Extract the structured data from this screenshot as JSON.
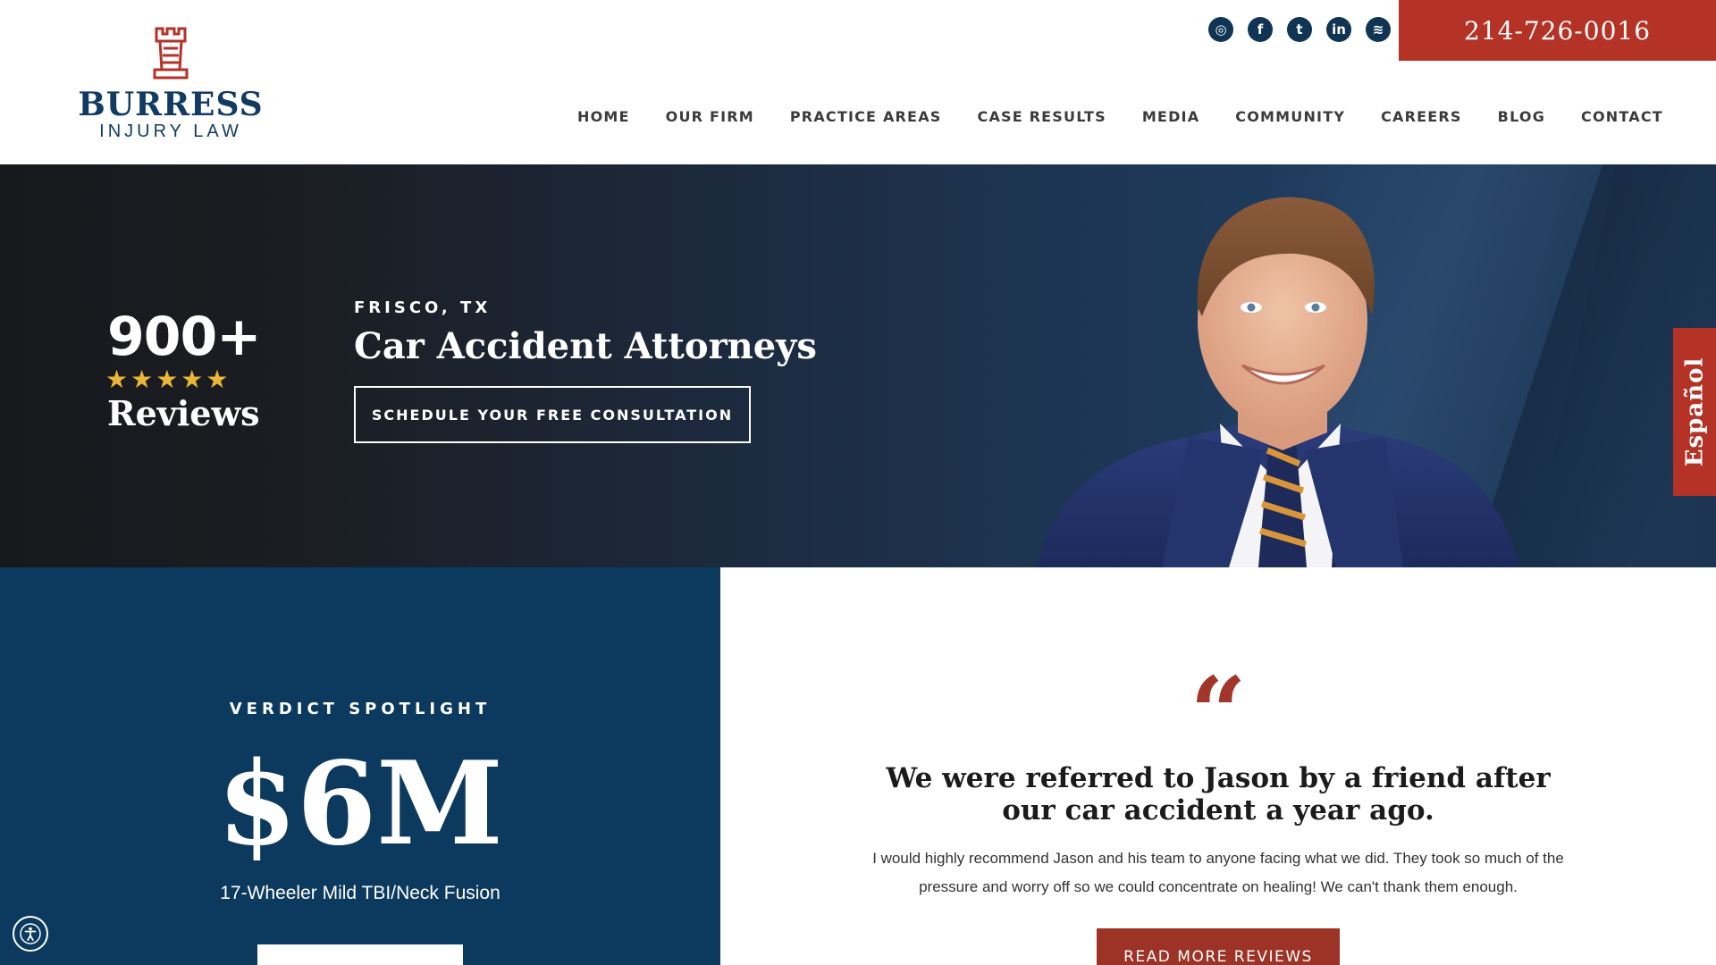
{
  "brand": {
    "name": "BURRESS",
    "tagline": "INJURY LAW",
    "colors": {
      "navy": "#123b63",
      "red": "#b53227",
      "gold": "#e9b63a"
    }
  },
  "social": [
    {
      "name": "instagram",
      "glyph": "◎"
    },
    {
      "name": "facebook",
      "glyph": "f"
    },
    {
      "name": "twitter",
      "glyph": "t"
    },
    {
      "name": "linkedin",
      "glyph": "in"
    },
    {
      "name": "spotify",
      "glyph": "≋"
    }
  ],
  "phone": "214-726-0016",
  "nav": [
    "HOME",
    "OUR FIRM",
    "PRACTICE AREAS",
    "CASE RESULTS",
    "MEDIA",
    "COMMUNITY",
    "CAREERS",
    "BLOG",
    "CONTACT"
  ],
  "hero": {
    "review_count": "900+",
    "stars": "★★★★★",
    "review_label": "Reviews",
    "location": "FRISCO, TX",
    "title": "Car Accident Attorneys",
    "cta": "SCHEDULE YOUR FREE CONSULTATION"
  },
  "language_tab": "Español",
  "verdict": {
    "label": "VERDICT SPOTLIGHT",
    "amount": "$6M",
    "case": "17-Wheeler Mild TBI/Neck Fusion"
  },
  "testimonial": {
    "quote_mark": "“",
    "headline": "We were referred to Jason by a friend after our car accident a year ago.",
    "body": "I would highly recommend Jason and his team to anyone facing what we did. They took so much of the pressure and worry off so we could concentrate on healing! We can't thank them enough.",
    "button": "READ MORE REVIEWS"
  }
}
